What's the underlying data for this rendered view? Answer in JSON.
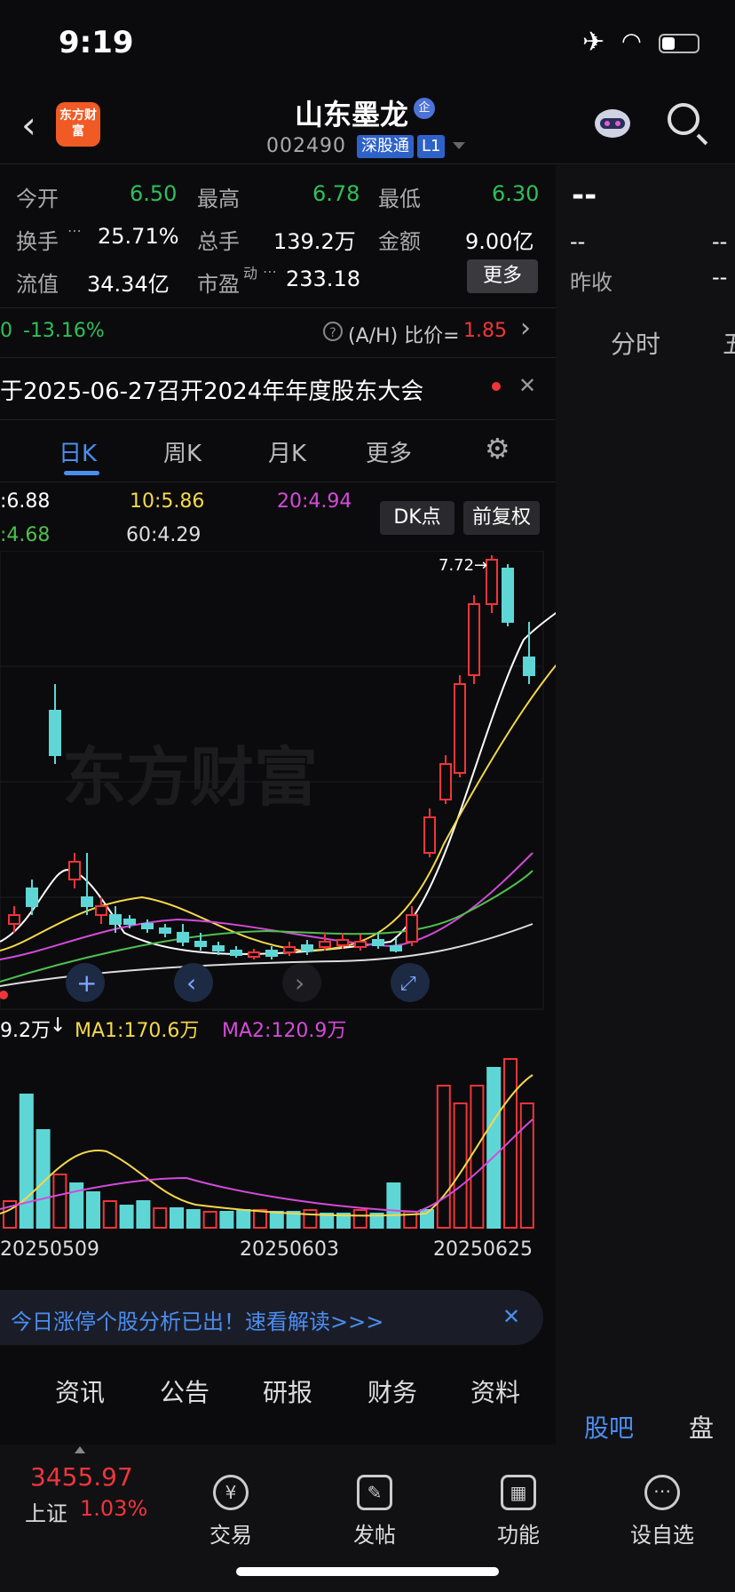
{
  "status": {
    "time": "9:19"
  },
  "header": {
    "logo_text": "东方财富",
    "stock_name": "山东墨龙",
    "badge": "企",
    "code": "002490",
    "tag1": "深股通",
    "tag2": "L1"
  },
  "quote": {
    "open_label": "今开",
    "open": "6.50",
    "high_label": "最高",
    "high": "6.78",
    "low_label": "最低",
    "low": "6.30",
    "turnover_label": "换手",
    "turnover": "25.71%",
    "volume_label": "总手",
    "volume": "139.2万",
    "amount_label": "金额",
    "amount": "9.00亿",
    "mcap_label": "流值",
    "mcap": "34.34亿",
    "pe_label": "市盈",
    "pe_sup": "动",
    "pe": "233.18",
    "more": "更多"
  },
  "right_panel": {
    "price": "--",
    "v1": "--",
    "v2": "--",
    "prev_label": "昨收",
    "v3": "--",
    "tab_fenshi": "分时",
    "tab_wu": "五",
    "tab_guba": "股吧",
    "tab_pankou": "盘口"
  },
  "ah": {
    "pct": "-13.16%",
    "label": "(A/H) 比价=",
    "value": "1.85",
    "left_mark": "0"
  },
  "notice": {
    "text": "于2025-06-27召开2024年年度股东大会"
  },
  "ktabs": {
    "day": "日K",
    "week": "周K",
    "month": "月K",
    "more": "更多"
  },
  "ma": {
    "ma5": ":6.88",
    "ma10": "10:5.86",
    "ma20": "20:4.94",
    "ma30": ":4.68",
    "ma60": "60:4.29",
    "dk": "DK点",
    "fq": "前复权",
    "peak": "7.72"
  },
  "watermark": "东方财富",
  "vol": {
    "v": "9.2万",
    "ma1": "MA1:170.6万",
    "ma2": "MA2:120.9万"
  },
  "dates": [
    "20250509",
    "20250603",
    "20250625"
  ],
  "banner": {
    "text": "今日涨停个股分析已出！速看解读>>>"
  },
  "bottom_tabs": [
    "资讯",
    "公告",
    "研报",
    "财务",
    "资料"
  ],
  "index": {
    "value": "3455.97",
    "name": "上证",
    "pct": "1.03%"
  },
  "tabbar": [
    "交易",
    "发帖",
    "功能",
    "设自选"
  ],
  "colors": {
    "up": "#f0353a",
    "down": "#5fd6d6",
    "bg": "#0b0b0d"
  }
}
